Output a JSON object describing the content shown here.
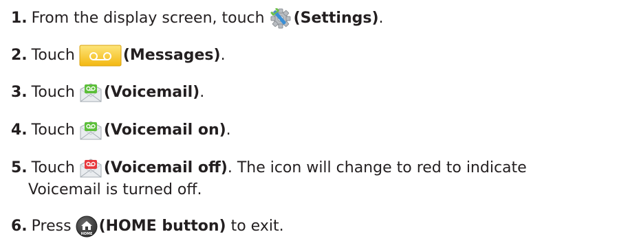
{
  "steps": [
    {
      "num": "1.",
      "pre": "From the display screen, touch",
      "icon": "settings-icon",
      "label": "(Settings)",
      "post": "."
    },
    {
      "num": "2.",
      "pre": "Touch",
      "icon": "messages-icon",
      "label": "(Messages)",
      "post": "."
    },
    {
      "num": "3.",
      "pre": "Touch",
      "icon": "voicemail-icon",
      "label": "(Voicemail)",
      "post": "."
    },
    {
      "num": "4.",
      "pre": "Touch",
      "icon": "voicemail-on-icon",
      "label": "(Voicemail on)",
      "post": "."
    },
    {
      "num": "5.",
      "pre": "Touch",
      "icon": "voicemail-off-icon",
      "label": "(Voicemail off)",
      "post": ". The icon will change to red to indicate",
      "post2": "Voicemail is turned off."
    },
    {
      "num": "6.",
      "pre": "Press",
      "icon": "home-button-icon",
      "label": "(HOME button)",
      "post": " to exit."
    }
  ],
  "icon_text": {
    "home": "HOME"
  },
  "colors": {
    "text": "#231f20",
    "messages_yellow": "#f7c21c",
    "voicemail_green": "#5cbf3a",
    "voicemail_red": "#e8383d",
    "settings_blue": "#3a8fd6",
    "home_gray": "#4a4a4a"
  }
}
